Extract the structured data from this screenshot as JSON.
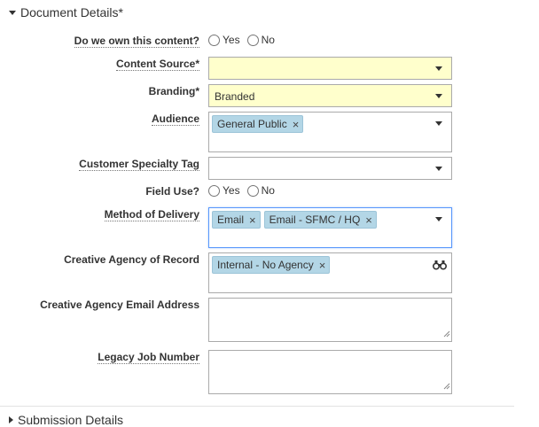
{
  "section": {
    "title": "Document Details*"
  },
  "footer_section": {
    "title": "Submission Details"
  },
  "fields": {
    "own_content": {
      "label": "Do we own this content?",
      "options": [
        "Yes",
        "No"
      ]
    },
    "content_source": {
      "label": "Content Source*",
      "value": ""
    },
    "branding": {
      "label": "Branding*",
      "value": "Branded"
    },
    "audience": {
      "label": "Audience",
      "chips": [
        "General Public"
      ]
    },
    "specialty_tag": {
      "label": "Customer Specialty Tag",
      "value": ""
    },
    "field_use": {
      "label": "Field Use?",
      "options": [
        "Yes",
        "No"
      ]
    },
    "method_delivery": {
      "label": "Method of Delivery",
      "chips": [
        "Email",
        "Email - SFMC / HQ"
      ]
    },
    "creative_agency": {
      "label": "Creative Agency of Record",
      "chips": [
        "Internal - No Agency"
      ]
    },
    "agency_email": {
      "label": "Creative Agency Email Address",
      "value": ""
    },
    "legacy_job": {
      "label": "Legacy Job Number",
      "value": ""
    }
  },
  "colors": {
    "required_bg": "#ffffcc",
    "chip_bg": "#b3d6e6",
    "focus_border": "#5897fb"
  },
  "icons": {
    "chip_remove": "×",
    "lookup": "binoculars-icon"
  }
}
